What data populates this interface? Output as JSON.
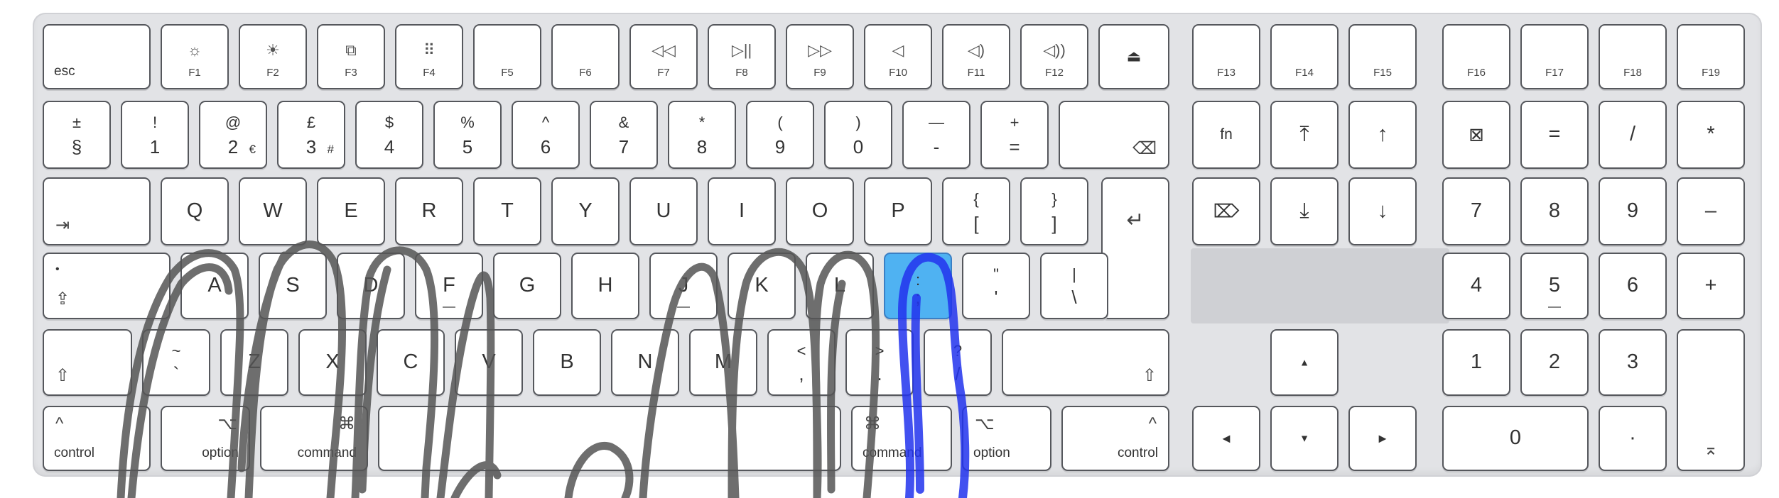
{
  "keyboard": {
    "function_row": {
      "esc": "esc",
      "f1": {
        "label": "F1",
        "icon": "☼"
      },
      "f2": {
        "label": "F2",
        "icon": "☀"
      },
      "f3": {
        "label": "F3",
        "icon": "⧉"
      },
      "f4": {
        "label": "F4",
        "icon": "⠿"
      },
      "f5": {
        "label": "F5"
      },
      "f6": {
        "label": "F6"
      },
      "f7": {
        "label": "F7",
        "icon": "◁◁"
      },
      "f8": {
        "label": "F8",
        "icon": "▷||"
      },
      "f9": {
        "label": "F9",
        "icon": "▷▷"
      },
      "f10": {
        "label": "F10",
        "icon": "◁"
      },
      "f11": {
        "label": "F11",
        "icon": "◁)"
      },
      "f12": {
        "label": "F12",
        "icon": "◁))"
      },
      "eject": "⏏",
      "f13": "F13",
      "f14": "F14",
      "f15": "F15",
      "f16": "F16",
      "f17": "F17",
      "f18": "F18",
      "f19": "F19"
    },
    "number_row": {
      "section": {
        "top": "±",
        "bottom": "§"
      },
      "k1": {
        "top": "!",
        "bottom": "1"
      },
      "k2": {
        "top": "@",
        "bottom": "2",
        "extra": "€"
      },
      "k3": {
        "top": "£",
        "bottom": "3",
        "extra": "#"
      },
      "k4": {
        "top": "$",
        "bottom": "4"
      },
      "k5": {
        "top": "%",
        "bottom": "5"
      },
      "k6": {
        "top": "^",
        "bottom": "6"
      },
      "k7": {
        "top": "&",
        "bottom": "7"
      },
      "k8": {
        "top": "*",
        "bottom": "8"
      },
      "k9": {
        "top": "(",
        "bottom": "9"
      },
      "k0": {
        "top": ")",
        "bottom": "0"
      },
      "minus": {
        "top": "—",
        "bottom": "-"
      },
      "equals": {
        "top": "+",
        "bottom": "="
      },
      "delete_icon": "⌫"
    },
    "qwerty_row": {
      "tab_icon": "⇥",
      "letters": [
        "Q",
        "W",
        "E",
        "R",
        "T",
        "Y",
        "U",
        "I",
        "O",
        "P"
      ],
      "bracket_left": {
        "top": "{",
        "bottom": "["
      },
      "bracket_right": {
        "top": "}",
        "bottom": "]"
      },
      "return_icon": "↵"
    },
    "home_row": {
      "caps_dot": "•",
      "caps_icon": "⇪",
      "letters": [
        "A",
        "S",
        "D",
        "F",
        "G",
        "H",
        "J",
        "K",
        "L"
      ],
      "semicolon": {
        "top": ":",
        "bottom": ";"
      },
      "quote": {
        "top": "\"",
        "bottom": "'"
      },
      "backslash": {
        "top": "|",
        "bottom": "\\"
      }
    },
    "shift_row": {
      "shift_icon": "⇧",
      "backtick": {
        "top": "~",
        "bottom": "`"
      },
      "letters": [
        "Z",
        "X",
        "C",
        "V",
        "B",
        "N",
        "M"
      ],
      "comma": {
        "top": "<",
        "bottom": ","
      },
      "period": {
        "top": ">",
        "bottom": "."
      },
      "slash": {
        "top": "?",
        "bottom": "/"
      }
    },
    "bottom_row": {
      "control_left": {
        "icon": "^",
        "label": "control"
      },
      "option_left": {
        "icon": "⌥",
        "label": "option"
      },
      "command_left": {
        "icon": "⌘",
        "label": "command"
      },
      "command_right": {
        "icon": "⌘",
        "label": "command"
      },
      "option_right": {
        "icon": "⌥",
        "label": "option"
      },
      "control_right": {
        "icon": "^",
        "label": "control"
      }
    },
    "nav_cluster": {
      "fn": "fn",
      "home_icon": "⤒",
      "page_up_icon": "↑",
      "forward_delete_icon": "⌦",
      "end_icon": "⤓",
      "page_down_icon": "↓",
      "arrow_up": "▲",
      "arrow_left": "◀",
      "arrow_down": "▼",
      "arrow_right": "▶"
    },
    "numpad": {
      "clear_icon": "⊠",
      "equals": "=",
      "divide": "/",
      "multiply": "*",
      "n7": "7",
      "n8": "8",
      "n9": "9",
      "minus": "–",
      "n4": "4",
      "n5": "5",
      "n6": "6",
      "plus": "+",
      "n1": "1",
      "n2": "2",
      "n3": "3",
      "n0": "0",
      "decimal": "·",
      "enter_icon": "⌅"
    },
    "highlight_color": "#4fb2f2",
    "scribble_color": "#555555",
    "scribble_blue": "#2233ee"
  }
}
